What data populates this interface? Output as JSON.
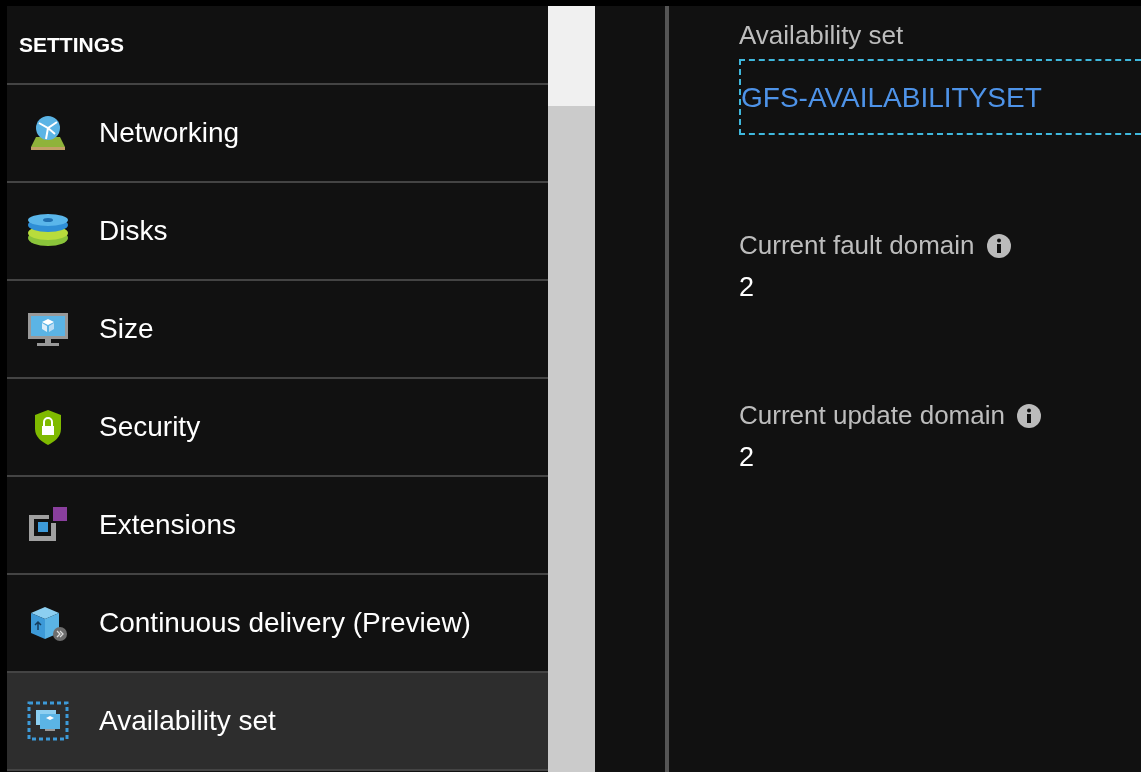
{
  "sidebar": {
    "heading": "SETTINGS",
    "items": [
      {
        "label": "Networking",
        "kind": "networking",
        "selected": false
      },
      {
        "label": "Disks",
        "kind": "disks",
        "selected": false
      },
      {
        "label": "Size",
        "kind": "size",
        "selected": false
      },
      {
        "label": "Security",
        "kind": "security",
        "selected": false
      },
      {
        "label": "Extensions",
        "kind": "extensions",
        "selected": false
      },
      {
        "label": "Continuous delivery (Preview)",
        "kind": "delivery",
        "selected": false
      },
      {
        "label": "Availability set",
        "kind": "availability",
        "selected": true
      }
    ]
  },
  "details": [
    {
      "label": "Availability set",
      "value": "GFS-AVAILABILITYSET",
      "kind": "link",
      "info": false
    },
    {
      "label": "Current fault domain",
      "value": "2",
      "kind": "text",
      "info": true
    },
    {
      "label": "Current update domain",
      "value": "2",
      "kind": "text",
      "info": true
    }
  ]
}
